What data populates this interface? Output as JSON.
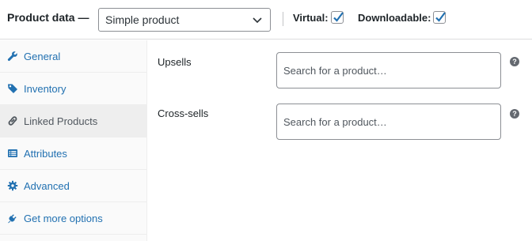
{
  "header": {
    "title": "Product data —",
    "product_type": "Simple product",
    "virtual_label": "Virtual:",
    "virtual_checked": true,
    "downloadable_label": "Downloadable:",
    "downloadable_checked": true
  },
  "sidebar": {
    "items": [
      {
        "label": "General",
        "icon": "wrench-icon",
        "active": false
      },
      {
        "label": "Inventory",
        "icon": "tag-icon",
        "active": false
      },
      {
        "label": "Linked Products",
        "icon": "link-icon",
        "active": true
      },
      {
        "label": "Attributes",
        "icon": "list-icon",
        "active": false
      },
      {
        "label": "Advanced",
        "icon": "gear-icon",
        "active": false
      },
      {
        "label": "Get more options",
        "icon": "plug-icon",
        "active": false
      }
    ]
  },
  "fields": {
    "upsells": {
      "label": "Upsells",
      "placeholder": "Search for a product…"
    },
    "cross_sells": {
      "label": "Cross-sells",
      "placeholder": "Search for a product…"
    },
    "help_glyph": "?"
  },
  "colors": {
    "link": "#2271b1",
    "checkbox": "#2271b1",
    "active_tab_bg": "#eeeeee"
  }
}
